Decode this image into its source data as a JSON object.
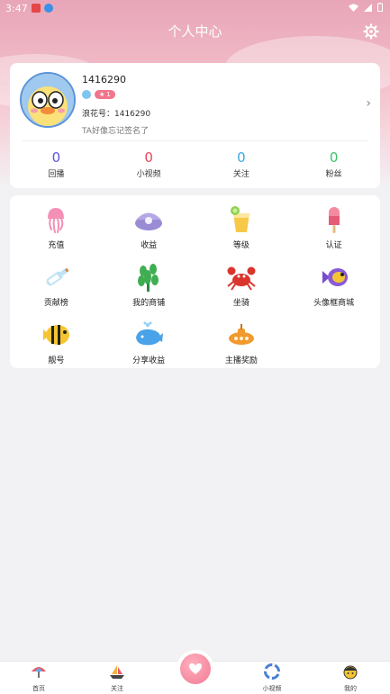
{
  "status_bar": {
    "time": "3:47"
  },
  "header": {
    "title": "个人中心"
  },
  "profile": {
    "username": "1416290",
    "level_badge": "1",
    "id_line": "浪花号：1416290",
    "signature": "TA好像忘记签名了"
  },
  "stats": [
    {
      "value": "0",
      "label": "回播",
      "color": "#5a55d8"
    },
    {
      "value": "0",
      "label": "小视频",
      "color": "#e8455a"
    },
    {
      "value": "0",
      "label": "关注",
      "color": "#3aa9e0"
    },
    {
      "value": "0",
      "label": "粉丝",
      "color": "#3fc16b"
    }
  ],
  "menu": [
    {
      "label": "充值",
      "icon": "jellyfish-icon"
    },
    {
      "label": "收益",
      "icon": "clam-icon"
    },
    {
      "label": "等级",
      "icon": "drink-icon"
    },
    {
      "label": "认证",
      "icon": "popsicle-icon"
    },
    {
      "label": "贡献榜",
      "icon": "bottle-icon"
    },
    {
      "label": "我的商铺",
      "icon": "seaweed-icon"
    },
    {
      "label": "坐骑",
      "icon": "crab-icon"
    },
    {
      "label": "头像框商城",
      "icon": "fish-icon"
    },
    {
      "label": "靓号",
      "icon": "striped-fish-icon"
    },
    {
      "label": "分享收益",
      "icon": "whale-icon"
    },
    {
      "label": "主播奖励",
      "icon": "submarine-icon"
    }
  ],
  "tabbar": {
    "home": "首页",
    "follow": "关注",
    "videos": "小视频",
    "mine": "我的"
  }
}
